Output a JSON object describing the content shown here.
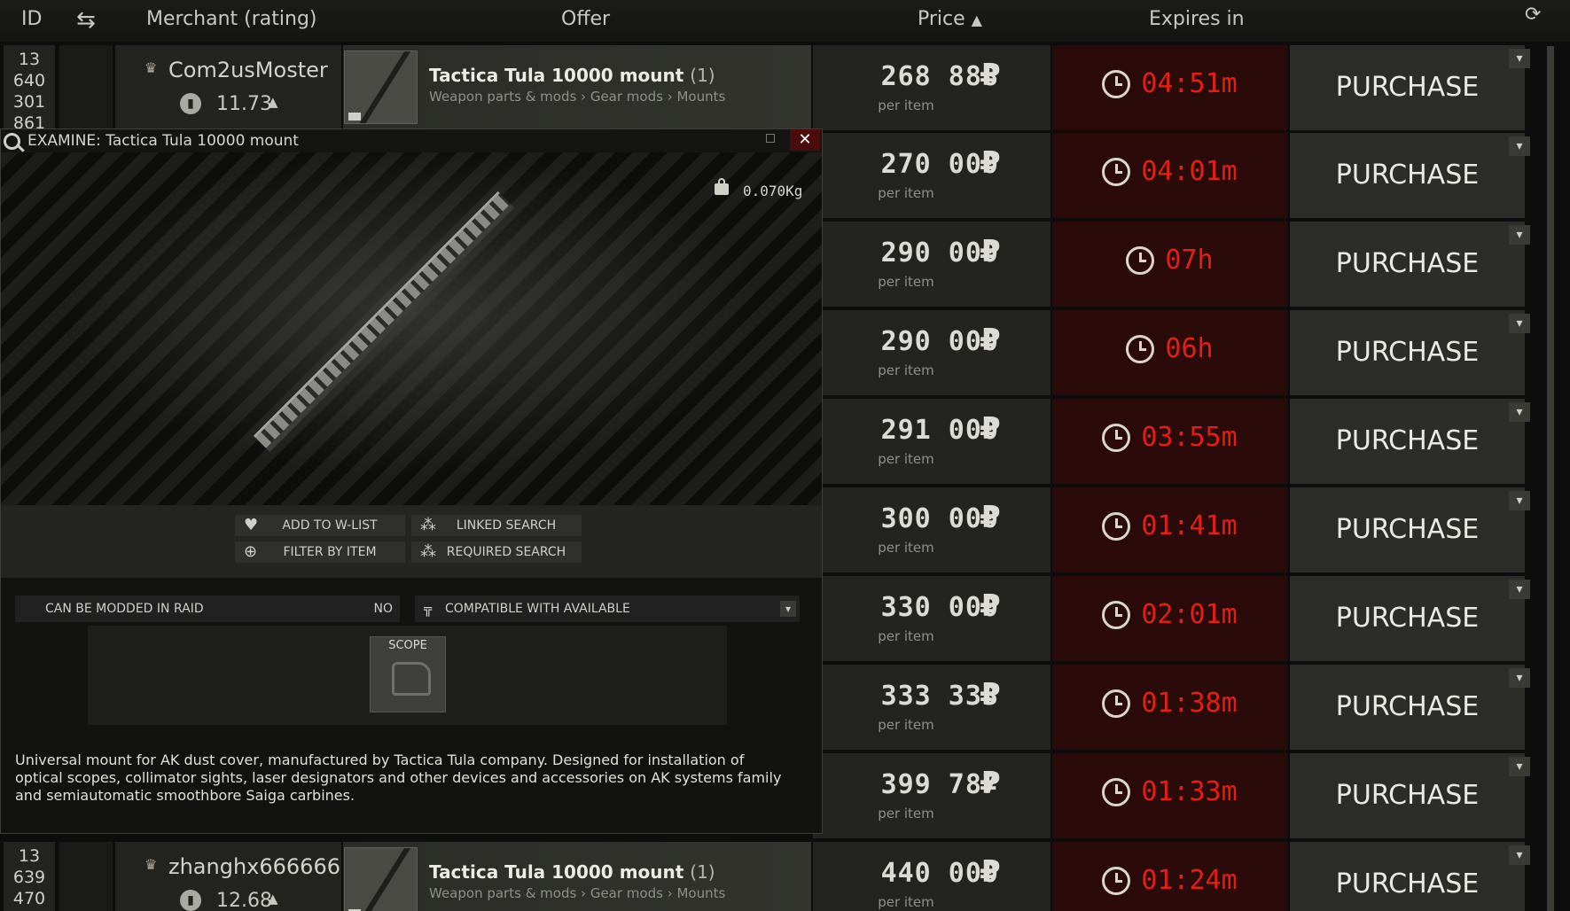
{
  "header": {
    "id": "ID",
    "merchant": "Merchant (rating)",
    "offer": "Offer",
    "price": "Price",
    "price_sort_icon": "caret-up",
    "expires": "Expires in",
    "refresh_icon": "refresh-swap-icon",
    "settings_icon": "circular-arrow-icon"
  },
  "rows": [
    {
      "id": [
        "13",
        "640",
        "301",
        "861"
      ],
      "merchant": "Com2usMoster",
      "rating": "11.73",
      "offer_title": "Tactica Tula 10000 mount",
      "offer_count": "(1)",
      "offer_path": "Weapon parts & mods › Gear mods › Mounts",
      "price": "268 888",
      "per_item": "per item",
      "expires": "04:51m",
      "purchase": "PURCHASE"
    },
    {
      "price": "270 000",
      "per_item": "per item",
      "expires": "04:01m",
      "purchase": "PURCHASE"
    },
    {
      "price": "290 000",
      "per_item": "per item",
      "expires": "07h",
      "purchase": "PURCHASE"
    },
    {
      "price": "290 000",
      "per_item": "per item",
      "expires": "06h",
      "purchase": "PURCHASE"
    },
    {
      "price": "291 000",
      "per_item": "per item",
      "expires": "03:55m",
      "purchase": "PURCHASE"
    },
    {
      "price": "300 000",
      "per_item": "per item",
      "expires": "01:41m",
      "purchase": "PURCHASE"
    },
    {
      "price": "330 000",
      "per_item": "per item",
      "expires": "02:01m",
      "purchase": "PURCHASE"
    },
    {
      "price": "333 333",
      "per_item": "per item",
      "expires": "01:38m",
      "purchase": "PURCHASE"
    },
    {
      "price": "399 787",
      "per_item": "per item",
      "expires": "01:33m",
      "purchase": "PURCHASE"
    },
    {
      "id": [
        "13",
        "639",
        "470"
      ],
      "merchant": "zhanghx666666",
      "rating": "12.68",
      "offer_title": "Tactica Tula 10000 mount",
      "offer_count": "(1)",
      "offer_path": "Weapon parts & mods › Gear mods › Mounts",
      "price": "440 000",
      "per_item": "per item",
      "expires": "01:24m",
      "purchase": "PURCHASE"
    }
  ],
  "examine": {
    "title": "EXAMINE: Tactica Tula 10000 mount",
    "weight": "0.070Kg",
    "actions": {
      "add_to_wlist": "ADD TO W-LIST",
      "linked_search": "LINKED SEARCH",
      "filter_by_item": "FILTER BY ITEM",
      "required_search": "REQUIRED SEARCH"
    },
    "modded_in_raid_label": "CAN BE MODDED IN RAID",
    "modded_in_raid_value": "NO",
    "compatible_label": "COMPATIBLE WITH AVAILABLE",
    "slot_label": "SCOPE",
    "description": "Universal mount for AK dust cover, manufactured by Tactica Tula company. Designed for installation of optical scopes, collimator sights, laser designators and other devices and accessories on AK systems family and semiautomatic smoothbore Saiga carbines."
  },
  "colors": {
    "expires_red": "#e21f14",
    "expires_bg": "#2a0b0a",
    "close_bg": "#4a0d0b"
  }
}
